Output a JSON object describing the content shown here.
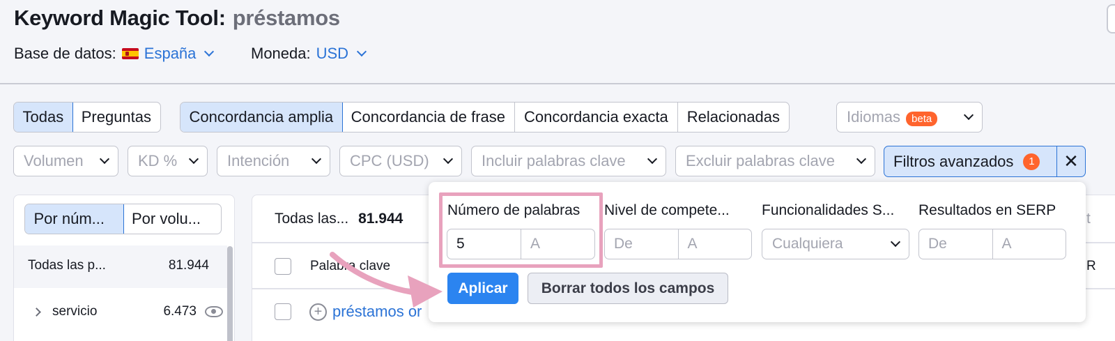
{
  "header": {
    "title": "Keyword Magic Tool:",
    "query": "préstamos",
    "database_label": "Base de datos:",
    "database_value": "España",
    "currency_label": "Moneda:",
    "currency_value": "USD"
  },
  "tabs_type": [
    "Todas",
    "Preguntas"
  ],
  "tabs_match": [
    "Concordancia amplia",
    "Concordancia de frase",
    "Concordancia exacta",
    "Relacionadas"
  ],
  "languages": {
    "label": "Idiomas",
    "badge": "beta"
  },
  "filters": {
    "volume": "Volumen",
    "kd": "KD %",
    "intent": "Intención",
    "cpc": "CPC (USD)",
    "include": "Incluir palabras clave",
    "exclude": "Excluir palabras clave",
    "advanced": "Filtros avanzados",
    "advanced_count": "1",
    "close": "✕"
  },
  "left_panel": {
    "toggle": [
      "Por núm...",
      "Por volu..."
    ],
    "all_label": "Todas las p...",
    "all_count": "81.944",
    "group_label": "servicio",
    "group_count": "6.473"
  },
  "main_panel": {
    "summary_label": "Todas las...",
    "summary_count": "81.944",
    "col_keyword": "Palabra clave",
    "row_keyword": "préstamos or",
    "edge_header": "t",
    "edge_col": "R",
    "edge_dots": "..."
  },
  "popup": {
    "words_label": "Número de palabras",
    "words_from": "5",
    "words_to_placeholder": "A",
    "competition_label": "Nivel de compete...",
    "competition_from_placeholder": "De",
    "competition_to_placeholder": "A",
    "features_label": "Funcionalidades S...",
    "features_value": "Cualquiera",
    "serp_label": "Resultados en SERP",
    "serp_from_placeholder": "De",
    "serp_to_placeholder": "A",
    "apply": "Aplicar",
    "clear": "Borrar todos los campos"
  },
  "colors": {
    "accent": "#2b73d6",
    "apply_button": "#2b84f0",
    "badge": "#ff642d",
    "highlight": "#e8a2bd",
    "arrow": "#e8a2bd"
  }
}
